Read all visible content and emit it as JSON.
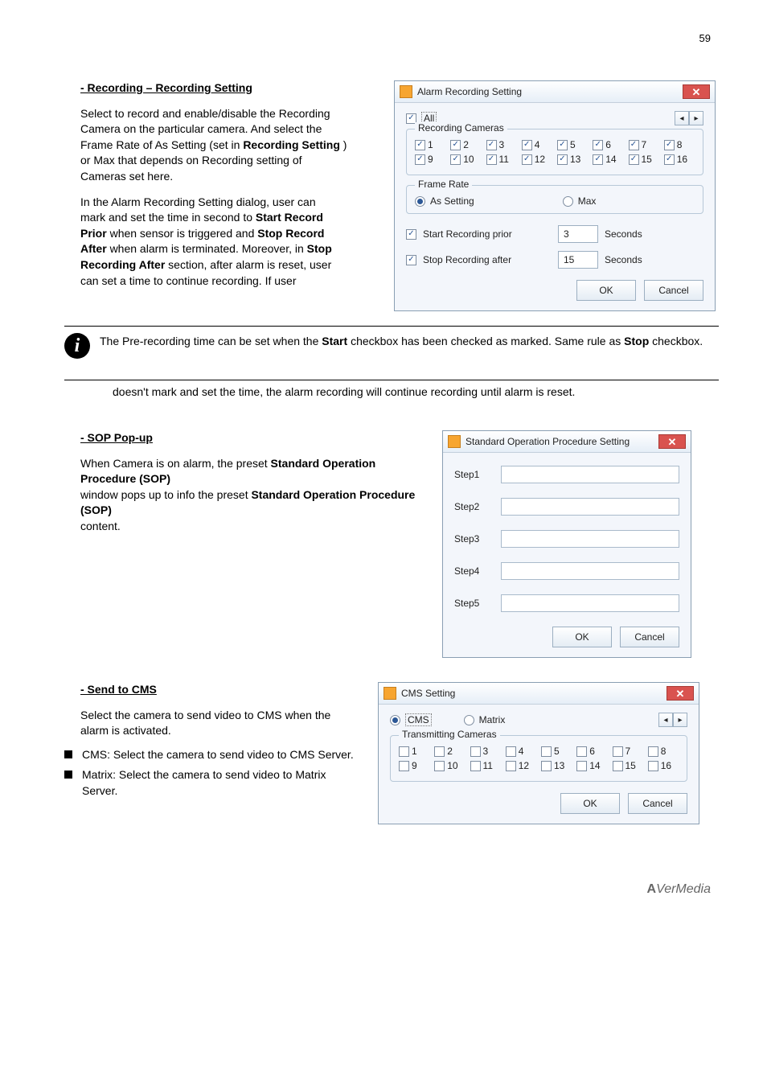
{
  "pageNumber": "59",
  "sectionRecording": {
    "title": "- Recording – Recording Setting",
    "line1": "Cameras set here.",
    "line2": "If user",
    "line2cont": "doesn't mark and set the time, the alarm recording will continue recording until alarm is reset."
  },
  "alarmDlg": {
    "title": "Alarm Recording Setting",
    "allLabel": "All",
    "groupCameras": "Recording Cameras",
    "camRow1": [
      "1",
      "2",
      "3",
      "4",
      "5",
      "6",
      "7",
      "8"
    ],
    "camRow2": [
      "9",
      "10",
      "11",
      "12",
      "13",
      "14",
      "15",
      "16"
    ],
    "groupFrame": "Frame Rate",
    "radioSetting": "As Setting",
    "radioMax": "Max",
    "startLabel": "Start Recording prior",
    "startVal": "3",
    "stopLabel": "Stop Recording after",
    "stopVal": "15",
    "secondsLabel": "Seconds",
    "ok": "OK",
    "cancel": "Cancel",
    "navLeft": "◂",
    "navRight": "▸"
  },
  "tip": {
    "heading": "The Pre-recording time can be set when the",
    "boldStart": "Start",
    "mid": "checkbox has been checked as marked. Same rule as",
    "boldStop": "Stop",
    "tail": "checkbox."
  },
  "sectionSOP": {
    "title": "- SOP Pop-up",
    "line1": "When Camera is on alarm, the preset",
    "line2": "window pops up to info the preset",
    "line3": "content.",
    "dlgTitle": "Standard Operation Procedure Setting",
    "steps": [
      "Step1",
      "Step2",
      "Step3",
      "Step4",
      "Step5"
    ],
    "ok": "OK",
    "cancel": "Cancel"
  },
  "sectionCMS": {
    "title": "- Send to CMS",
    "intro": "Select the camera to send video to CMS when the alarm is activated.",
    "bulletCMS": "CMS: Select the camera to send video to CMS Server.",
    "bulletMatrix": "Matrix: Select the camera to send video to Matrix Server.",
    "dlgTitle": "CMS Setting",
    "radioCMS": "CMS",
    "radioMatrix": "Matrix",
    "navLeft": "◂",
    "navRight": "▸",
    "groupCameras": "Transmitting Cameras",
    "camRow1": [
      "1",
      "2",
      "3",
      "4",
      "5",
      "6",
      "7",
      "8"
    ],
    "camRow2": [
      "9",
      "10",
      "11",
      "12",
      "13",
      "14",
      "15",
      "16"
    ],
    "ok": "OK",
    "cancel": "Cancel"
  },
  "brand": {
    "a": "A",
    "rest": "VerMedia"
  }
}
